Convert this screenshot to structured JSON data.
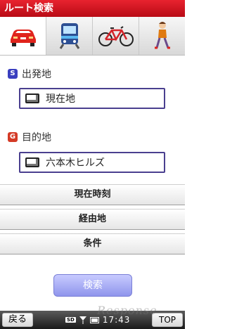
{
  "title": "ルート検索",
  "tabs": [
    {
      "name": "car-icon",
      "active": true
    },
    {
      "name": "train-icon",
      "active": false
    },
    {
      "name": "bicycle-icon",
      "active": false
    },
    {
      "name": "walk-icon",
      "active": false
    }
  ],
  "origin": {
    "badge": "S",
    "label": "出発地",
    "value": "現在地",
    "badge_color": "#3a3fbf"
  },
  "destination": {
    "badge": "G",
    "label": "目的地",
    "value": "六本木ヒルズ",
    "badge_color": "#d43a26"
  },
  "rows": [
    "現在時刻",
    "経由地",
    "条件"
  ],
  "search_label": "検索",
  "bottom": {
    "back": "戻る",
    "sd": "SD",
    "time": "17:43",
    "top": "TOP"
  },
  "watermark": "Response"
}
